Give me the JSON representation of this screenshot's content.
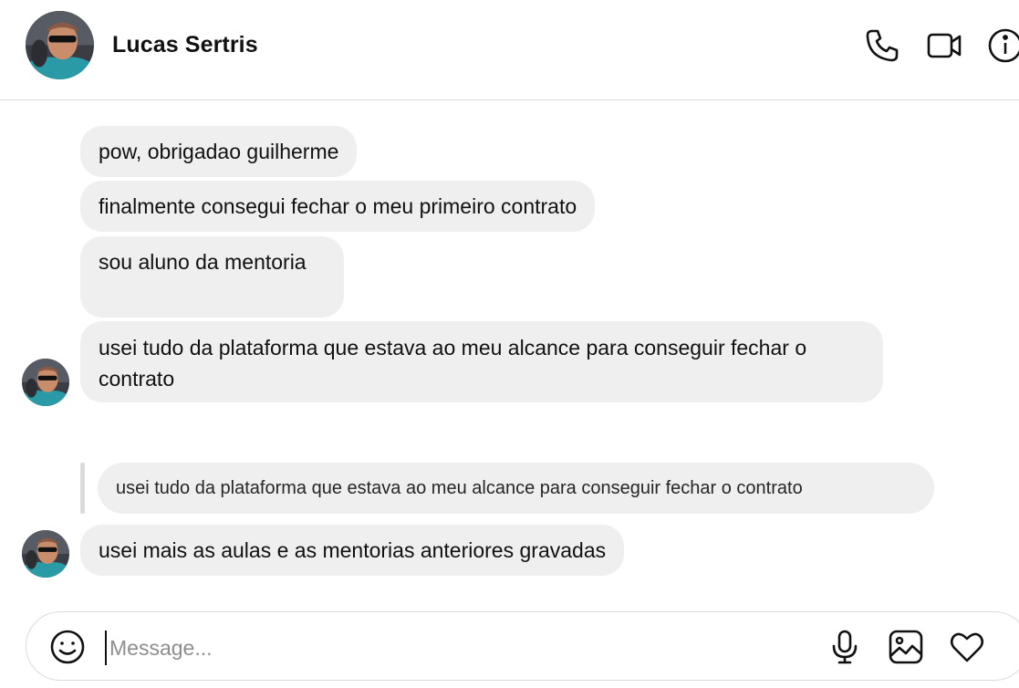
{
  "header": {
    "contact_name": "Lucas Sertris",
    "icons": [
      "phone-icon",
      "video-camera-icon",
      "info-icon"
    ]
  },
  "messages": [
    {
      "text": "pow, obrigadao guilherme"
    },
    {
      "text": "finalmente consegui fechar o meu primeiro contrato"
    },
    {
      "text": "sou aluno da mentoria"
    },
    {
      "text": "usei tudo da plataforma que estava ao meu alcance para conseguir fechar o contrato"
    },
    {
      "reply_to": "usei tudo da plataforma que estava ao meu alcance para conseguir fechar o contrato",
      "text": "usei mais as aulas e as mentorias anteriores gravadas"
    }
  ],
  "composer": {
    "placeholder": "Message...",
    "icons": [
      "emoji-icon",
      "microphone-icon",
      "image-icon",
      "heart-icon"
    ]
  },
  "colors": {
    "bubble_background": "#efefef",
    "divider": "#dbdbdb",
    "placeholder": "#8e8e8e"
  }
}
